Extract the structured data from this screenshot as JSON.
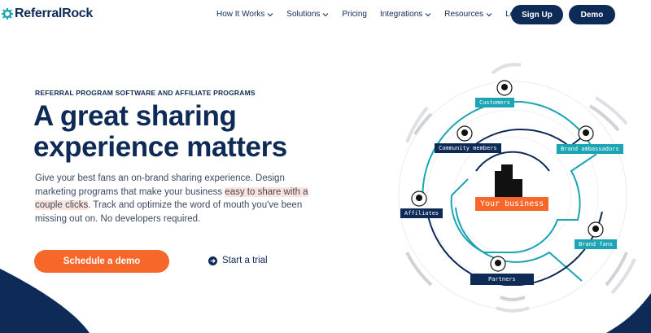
{
  "header": {
    "logo": {
      "part1": "Referral",
      "part2": "Rock"
    },
    "nav": [
      {
        "label": "How It Works",
        "has_dropdown": true
      },
      {
        "label": "Solutions",
        "has_dropdown": true
      },
      {
        "label": "Pricing",
        "has_dropdown": false
      },
      {
        "label": "Integrations",
        "has_dropdown": true
      },
      {
        "label": "Resources",
        "has_dropdown": true
      },
      {
        "label": "Login",
        "has_dropdown": false
      }
    ],
    "signup_label": "Sign Up",
    "demo_label": "Demo"
  },
  "hero": {
    "eyebrow": "REFERRAL PROGRAM SOFTWARE AND AFFILIATE PROGRAMS",
    "headline_line1": "A great sharing",
    "headline_line2": "experience matters",
    "body_before": "Give your best fans an on-brand sharing experience. Design marketing programs that make your business ",
    "body_highlight": "easy to share with a couple clicks",
    "body_after": ". Track and optimize the word of mouth you've been missing out on. No developers required.",
    "cta_primary": "Schedule a demo",
    "cta_secondary": "Start a trial"
  },
  "diagram": {
    "center_label": "Your business",
    "nodes": {
      "customers": "Customers",
      "community": "Community members",
      "ambassadors": "Brand ambassadors",
      "affiliates": "Affiliates",
      "fans": "Brand fans",
      "partners": "Partners"
    }
  },
  "colors": {
    "navy": "#0e2a57",
    "orange": "#f76729",
    "teal": "#1ba4b3",
    "highlight": "#fde3d9"
  }
}
